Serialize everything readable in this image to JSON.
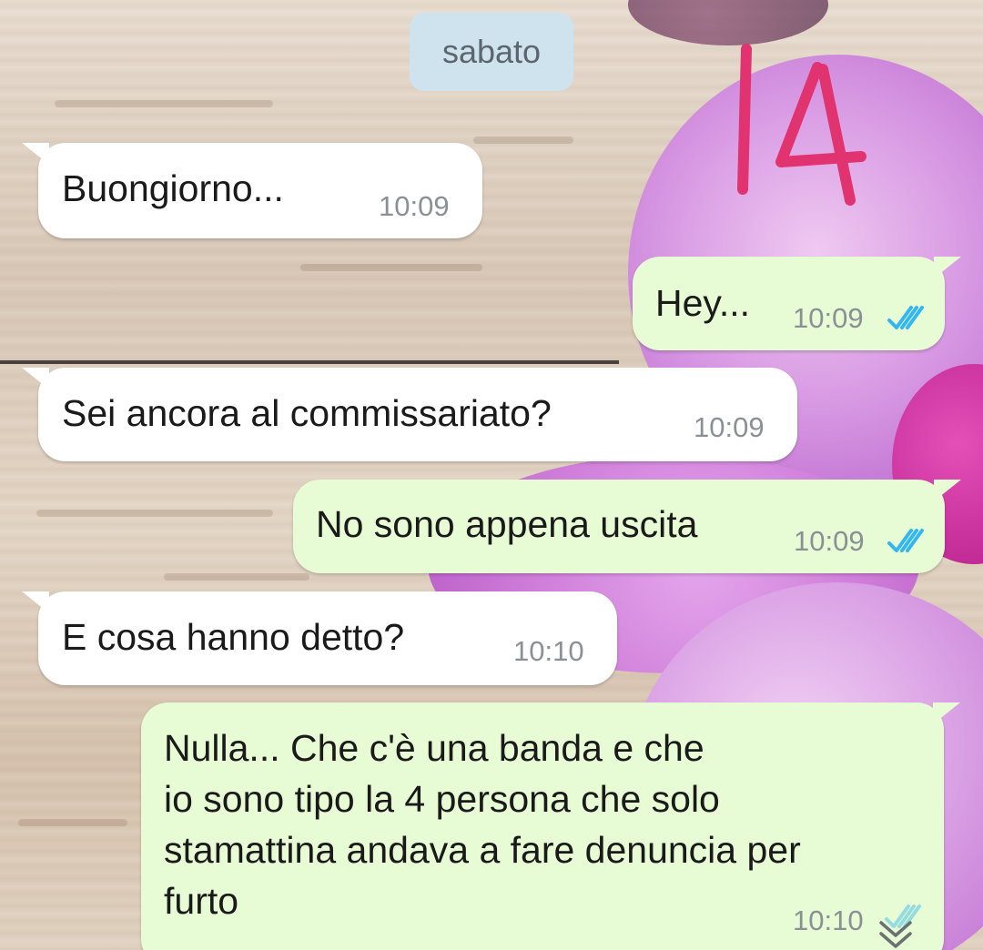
{
  "chat": {
    "date_label": "sabato",
    "overlay_number": "14",
    "colors": {
      "incoming_bubble": "#ffffff",
      "outgoing_bubble": "#e7fbd4",
      "date_pill": "#cfe3ee",
      "read_ticks": "#34b7f1",
      "overlay_number": "#e0336f"
    },
    "messages": [
      {
        "direction": "incoming",
        "text": "Buongiorno...",
        "time": "10:09"
      },
      {
        "direction": "outgoing",
        "text": "Hey...",
        "time": "10:09",
        "status": "read"
      },
      {
        "direction": "incoming",
        "text": "Sei ancora al commissariato?",
        "time": "10:09"
      },
      {
        "direction": "outgoing",
        "text": "No sono appena uscita",
        "time": "10:09",
        "status": "read"
      },
      {
        "direction": "incoming",
        "text": "E cosa hanno detto?",
        "time": "10:10"
      },
      {
        "direction": "outgoing",
        "lines": [
          "Nulla... Che c'è una banda e che",
          "io sono tipo la 4 persona che solo",
          "stamattina andava a fare denuncia per",
          "furto"
        ],
        "time": "10:10",
        "status": "read"
      }
    ]
  }
}
